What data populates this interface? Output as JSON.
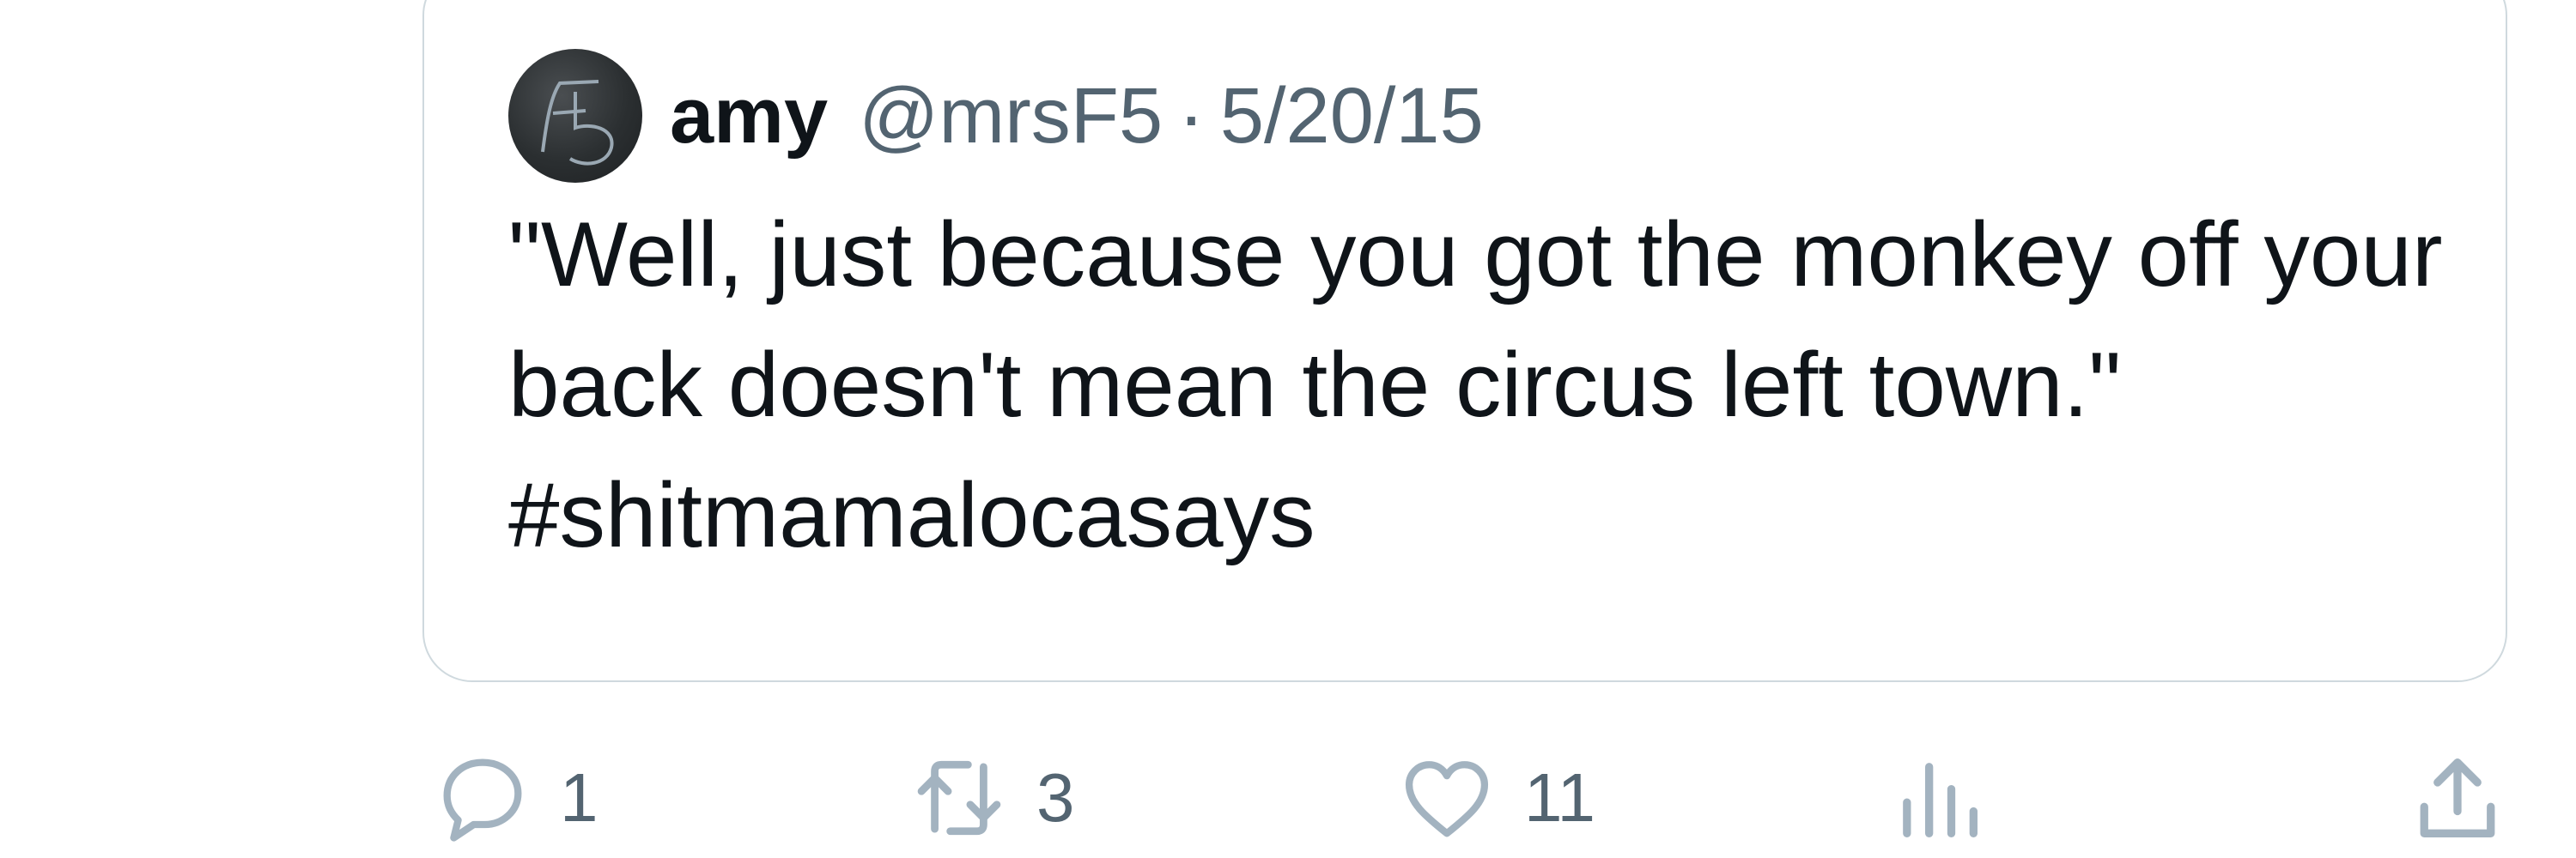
{
  "quoted_tweet": {
    "author_name": "amy",
    "author_handle": "@mrsF5",
    "separator": "·",
    "date": "5/20/15",
    "text_main": "\"Well, just because you got the monkey off your back doesn't mean the circus left town.\"",
    "hashtag": "#shitmamalocasays"
  },
  "actions": {
    "reply": {
      "icon": "reply-icon",
      "count": "1"
    },
    "retweet": {
      "icon": "retweet-icon",
      "count": "3"
    },
    "like": {
      "icon": "heart-icon",
      "count": "11"
    },
    "views": {
      "icon": "views-bar-chart-icon"
    },
    "share": {
      "icon": "share-upload-icon"
    }
  },
  "colors": {
    "text_primary": "#0f1419",
    "text_secondary": "#536471",
    "border": "#cfd9de",
    "icon": "#8899a6"
  }
}
